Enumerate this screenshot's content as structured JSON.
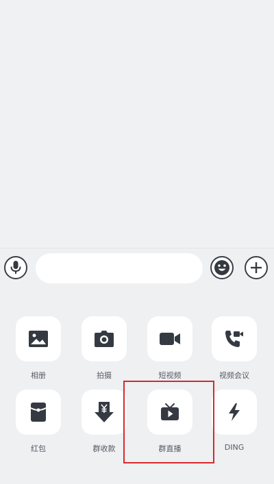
{
  "input_bar": {
    "voice_icon": "microphone-icon",
    "message_placeholder": "",
    "emoji_icon": "smiley-face-icon",
    "more_icon": "plus-circle-icon"
  },
  "panel": {
    "items": [
      {
        "label": "相册",
        "icon": "image-icon"
      },
      {
        "label": "拍摄",
        "icon": "camera-icon"
      },
      {
        "label": "短视频",
        "icon": "video-camera-icon"
      },
      {
        "label": "视频会议",
        "icon": "video-call-icon"
      },
      {
        "label": "红包",
        "icon": "red-packet-icon"
      },
      {
        "label": "群收款",
        "icon": "group-payment-icon"
      },
      {
        "label": "群直播",
        "icon": "live-tv-icon"
      },
      {
        "label": "DING",
        "icon": "lightning-icon"
      }
    ],
    "highlighted_item": "群直播"
  },
  "colors": {
    "background": "#eff1f3",
    "icon": "#353a42",
    "highlight_border": "#d7282e"
  }
}
